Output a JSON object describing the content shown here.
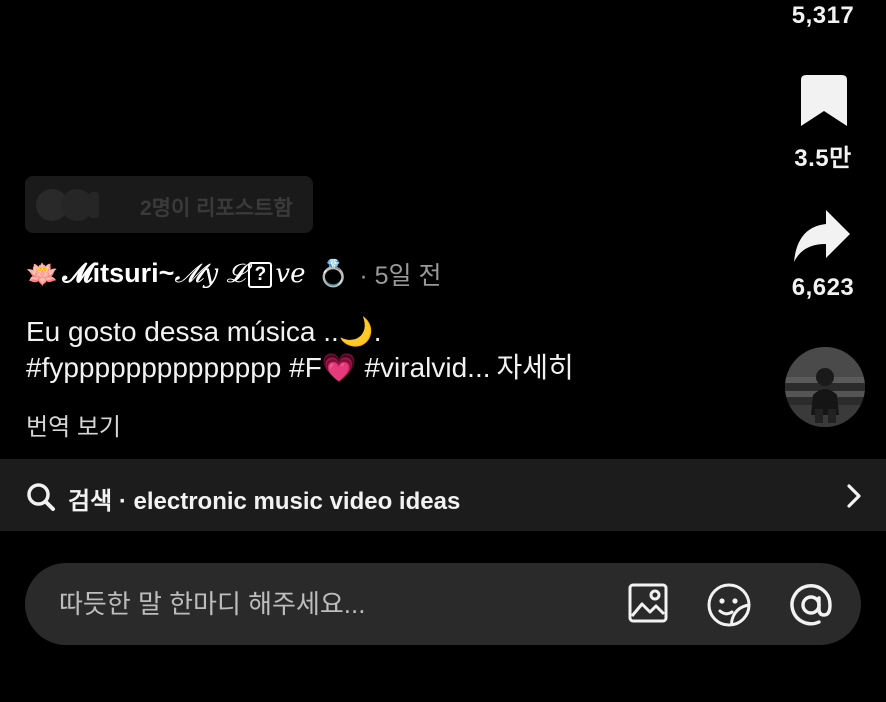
{
  "actions": {
    "likes_count": "5,317",
    "bookmark_count": "3.5만",
    "share_count": "6,623"
  },
  "repost": {
    "text": "2명이 리포스트함"
  },
  "author": {
    "emoji": "🪷",
    "name_part1": "𝓜itsuri~",
    "name_part2": "𝓜y 𝓛",
    "name_box": "?",
    "name_part3": "ve",
    "ring_emoji": "💍",
    "time": "· 5일 전"
  },
  "caption": {
    "line1": "Eu gosto dessa música ..🌙.",
    "line2": "#fypppppppppppppp #F💗 #viralvid...",
    "see_more": "자세히"
  },
  "translate_label": "번역 보기",
  "search": {
    "label": "검색 · electronic music video ideas"
  },
  "comment": {
    "placeholder": "따듯한 말 한마디 해주세요..."
  },
  "icons": {
    "bookmark": "bookmark-icon",
    "share": "share-icon",
    "search": "search-icon",
    "chevron": "chevron-right-icon",
    "image": "image-icon",
    "sticker": "sticker-icon",
    "mention": "mention-icon"
  }
}
